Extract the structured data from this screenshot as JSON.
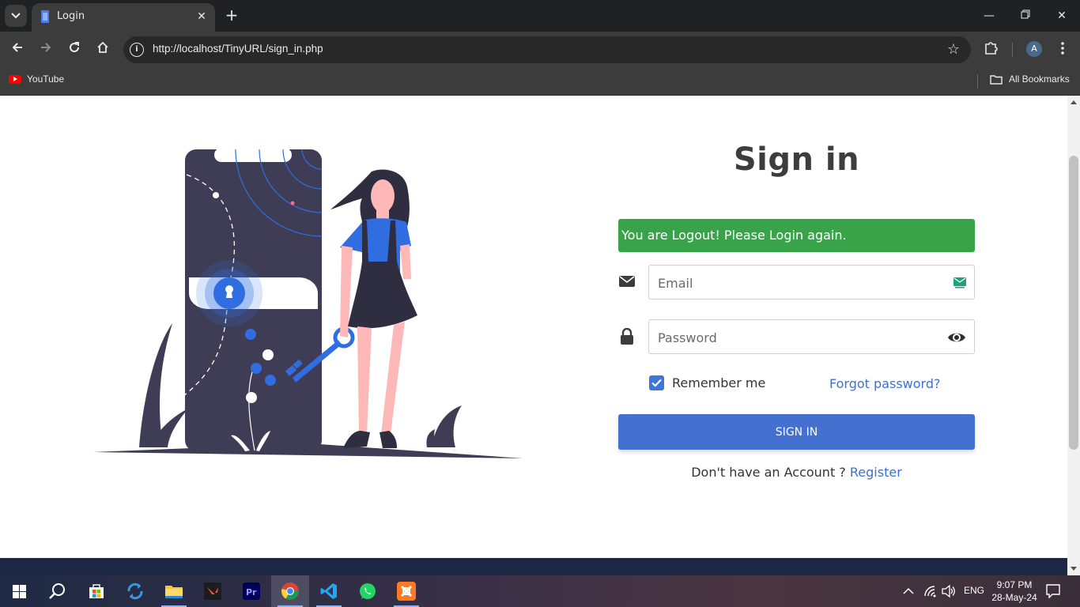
{
  "browser": {
    "tab_title": "Login",
    "url": "http://localhost/TinyURL/sign_in.php",
    "profile_initial": "A",
    "bookmarks": [
      {
        "label": "YouTube",
        "icon": "youtube-icon"
      }
    ],
    "all_bookmarks_label": "All Bookmarks"
  },
  "signin": {
    "title": "Sign in",
    "alert": "You are Logout! Please Login again.",
    "email_placeholder": "Email",
    "password_placeholder": "Password",
    "remember_label": "Remember me",
    "remember_checked": true,
    "forgot_label": "Forgot password?",
    "button_label": "SIGN IN",
    "no_account_text": "Don't have an Account ? ",
    "register_label": "Register"
  },
  "colors": {
    "alert_bg": "#39a34a",
    "button_bg": "#4471cf",
    "link": "#3f6fd1",
    "illustration_dark": "#3f3d56",
    "illustration_accent": "#2f6de1",
    "footer_bar": "#1c2843"
  },
  "taskbar": {
    "apps": [
      "windows-start",
      "search",
      "microsoft-store",
      "sync",
      "file-explorer",
      "valorant",
      "premiere-pro",
      "chrome",
      "vs-code",
      "whatsapp",
      "xampp"
    ],
    "language": "ENG",
    "time": "9:07 PM",
    "date": "28-May-24"
  }
}
